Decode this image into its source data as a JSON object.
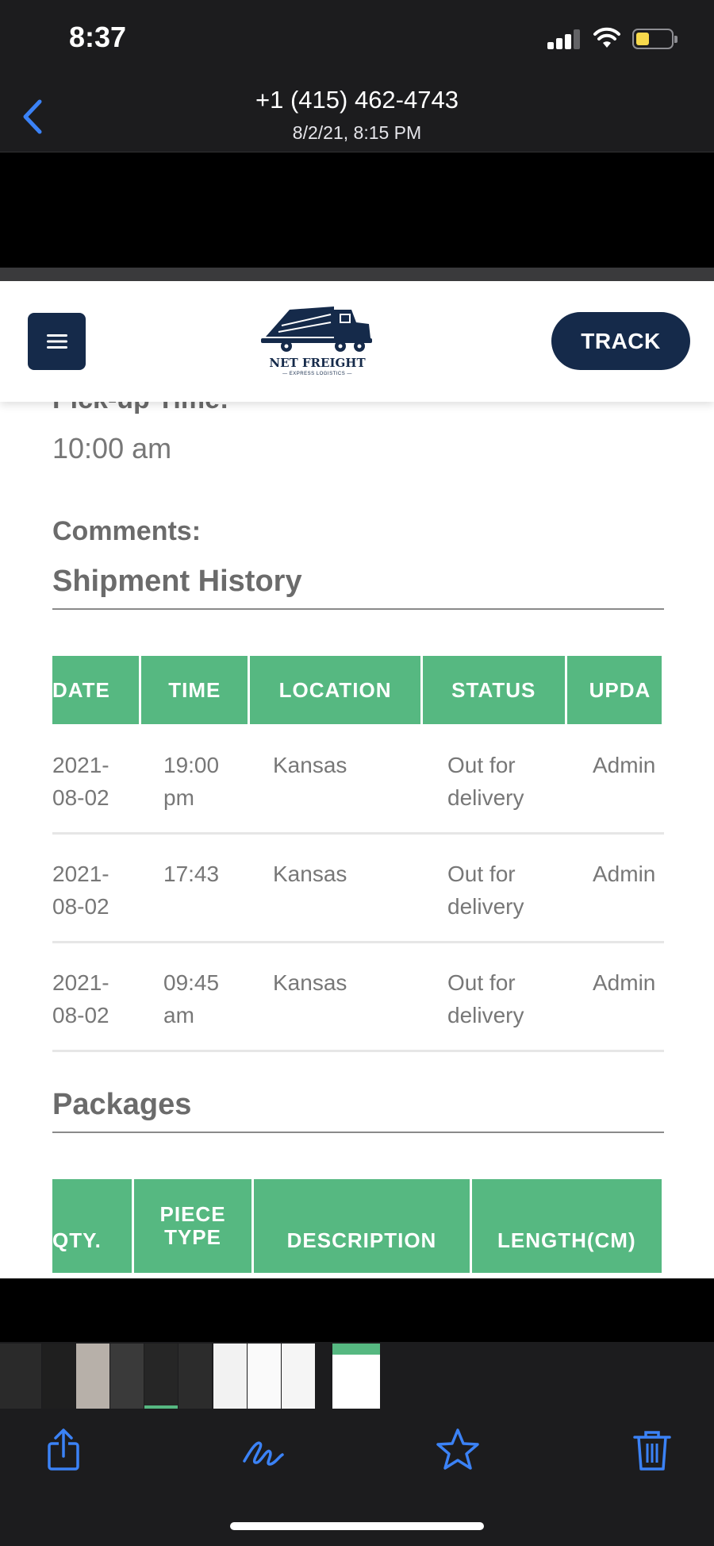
{
  "status_bar": {
    "time": "8:37"
  },
  "nav": {
    "title": "+1 (415) 462-4743",
    "subtitle": "8/2/21, 8:15 PM"
  },
  "site": {
    "logo_text": "NET FREIGHT",
    "logo_sub": "— EXPRESS LOGISTICS —",
    "track_label": "TRACK"
  },
  "details": {
    "pickup_label": "Pick-up Time:",
    "pickup_value": "10:00 am",
    "comments_label": "Comments:"
  },
  "history": {
    "title": "Shipment History",
    "headers": [
      "DATE",
      "TIME",
      "LOCATION",
      "STATUS",
      "UPDA"
    ],
    "rows": [
      {
        "date": "2021-\n08-02",
        "time": "19:00\npm",
        "location": "Kansas",
        "status": "Out for\ndelivery",
        "updated_by": "Admin"
      },
      {
        "date": "2021-\n08-02",
        "time": "17:43",
        "location": "Kansas",
        "status": "Out for\ndelivery",
        "updated_by": "Admin"
      },
      {
        "date": "2021-\n08-02",
        "time": "09:45\nam",
        "location": "Kansas",
        "status": "Out for\ndelivery",
        "updated_by": "Admin"
      }
    ]
  },
  "packages": {
    "title": "Packages",
    "headers": [
      "QTY.",
      "PIECE\nTYPE",
      "DESCRIPTION",
      "LENGTH(CM)"
    ]
  },
  "colors": {
    "navy": "#152a4a",
    "table_green": "#56b881",
    "ios_blue": "#3b82f6"
  },
  "toolbar_icons": [
    "share-icon",
    "markup-icon",
    "favorite-icon",
    "trash-icon"
  ]
}
